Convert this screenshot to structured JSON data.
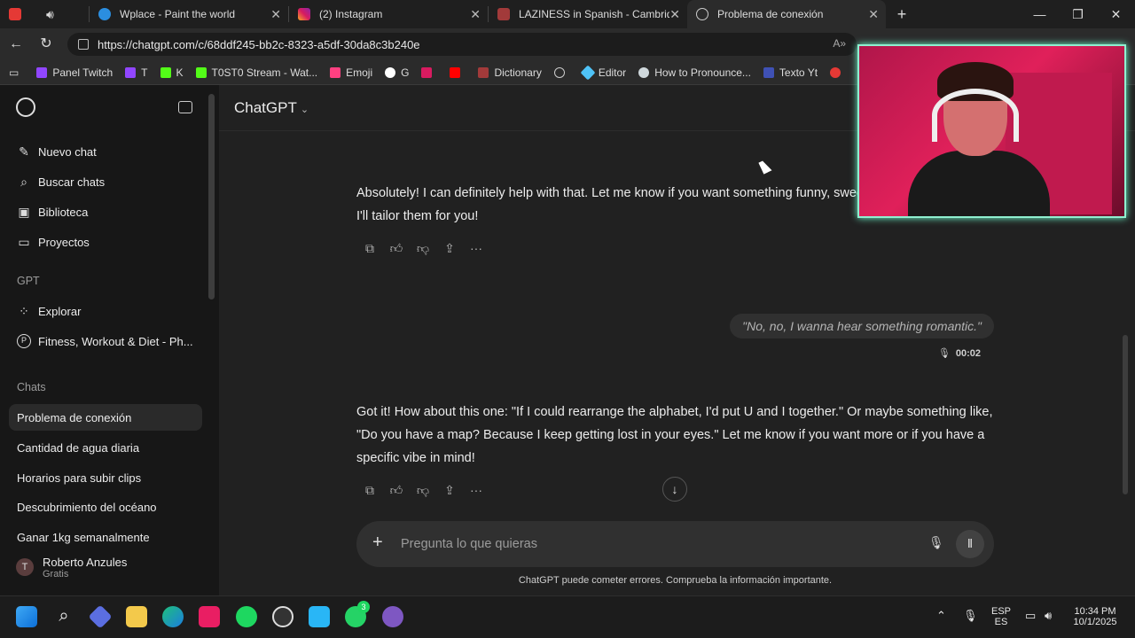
{
  "browser": {
    "tabs": [
      {
        "title": "Wplace - Paint the world"
      },
      {
        "title": "(2) Instagram"
      },
      {
        "title": "LAZINESS in Spanish - Cambridge"
      },
      {
        "title": "Problema de conexión"
      }
    ],
    "url": "https://chatgpt.com/c/68ddf245-bb2c-8323-a5df-30da8c3b240e",
    "bookmarks": [
      "Panel Twitch",
      "T",
      "K",
      "T0ST0 Stream - Wat...",
      "Emoji",
      "G",
      "Dictionary",
      "Editor",
      "How to Pronounce...",
      "Texto Yt"
    ]
  },
  "sidebar": {
    "actions": [
      {
        "label": "Nuevo chat",
        "icon": "new-chat-icon"
      },
      {
        "label": "Buscar chats",
        "icon": "search-icon"
      },
      {
        "label": "Biblioteca",
        "icon": "library-icon"
      },
      {
        "label": "Proyectos",
        "icon": "folder-icon"
      }
    ],
    "gpt_heading": "GPT",
    "gpts": [
      {
        "label": "Explorar",
        "icon": "grid-icon"
      },
      {
        "label": "Fitness, Workout & Diet - Ph...",
        "icon": "gpt-avatar-icon"
      }
    ],
    "chats_heading": "Chats",
    "chats": [
      "Problema de conexión",
      "Cantidad de agua diaria",
      "Horarios para subir clips",
      "Descubrimiento del océano",
      "Ganar 1kg semanalmente"
    ],
    "user": {
      "initial": "T",
      "name": "Roberto Anzules",
      "plan": "Gratis"
    }
  },
  "header": {
    "model": "ChatGPT"
  },
  "conversation": {
    "assistant_1": "Absolutely! I can definitely help with that. Let me know if you want something funny, sweet, or super cheesy, and I'll tailor them for you!",
    "user_voice": "\"No, no, I wanna hear something romantic.\"",
    "user_voice_duration": "00:02",
    "assistant_2": "Got it! How about this one: \"If I could rearrange the alphabet, I'd put U and I together.\" Or maybe something like, \"Do you have a map? Because I keep getting lost in your eyes.\" Let me know if you want more or if you have a specific vibe in mind!"
  },
  "composer": {
    "placeholder": "Pregunta lo que quieras",
    "disclaimer": "ChatGPT puede cometer errores. Comprueba la información importante."
  },
  "taskbar": {
    "lang_1": "ESP",
    "lang_2": "ES",
    "time": "10:34 PM",
    "date": "10/1/2025",
    "whatsapp_badge": "3"
  }
}
